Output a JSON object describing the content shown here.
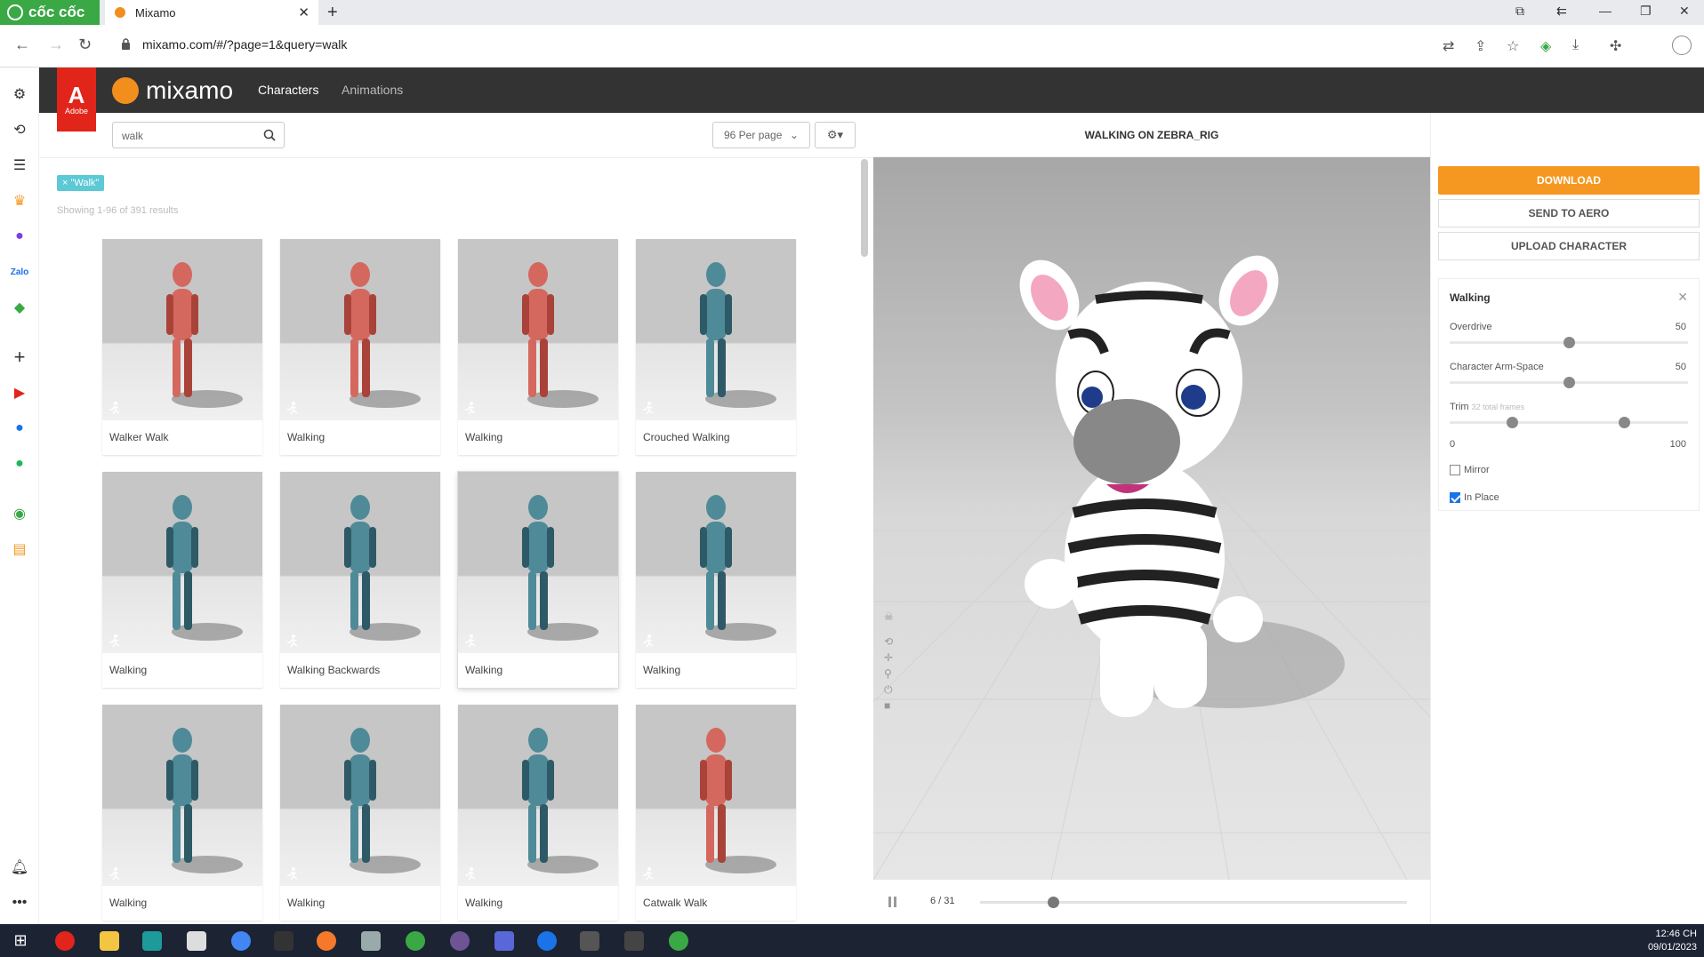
{
  "browser": {
    "brand": "cốc cốc",
    "tab_title": "Mixamo",
    "url": "mixamo.com/#/?page=1&query=walk"
  },
  "mixamo": {
    "logo_text": "mixamo",
    "adobe_label": "Adobe",
    "nav": [
      {
        "label": "Characters",
        "active": true
      },
      {
        "label": "Animations",
        "active": false
      }
    ]
  },
  "browse": {
    "search_value": "walk",
    "per_page": "96 Per page",
    "filter_chip": "× \"Walk\"",
    "results_text": "Showing 1-96 of 391 results",
    "cards": [
      {
        "label": "Walker Walk",
        "color": "red"
      },
      {
        "label": "Walking",
        "color": "red"
      },
      {
        "label": "Walking",
        "color": "red"
      },
      {
        "label": "Crouched Walking",
        "color": "blue"
      },
      {
        "label": "Walking",
        "color": "blue"
      },
      {
        "label": "Walking Backwards",
        "color": "blue"
      },
      {
        "label": "Walking",
        "color": "blue"
      },
      {
        "label": "Walking",
        "color": "blue"
      },
      {
        "label": "Walking",
        "color": "blue"
      },
      {
        "label": "Walking",
        "color": "blue"
      },
      {
        "label": "Walking",
        "color": "blue"
      },
      {
        "label": "Catwalk Walk",
        "color": "red"
      }
    ]
  },
  "viewer": {
    "title": "WALKING ON ZEBRA_RIG",
    "frame_label": "6 / 31",
    "timeline_progress": 0.17
  },
  "panel": {
    "download_label": "DOWNLOAD",
    "aero_label": "SEND TO AERO",
    "upload_label": "UPLOAD CHARACTER",
    "animation_name": "Walking",
    "overdrive_label": "Overdrive",
    "overdrive_value": "50",
    "overdrive_fraction": 0.5,
    "armspace_label": "Character Arm-Space",
    "armspace_value": "50",
    "armspace_fraction": 0.5,
    "trim_label": "Trim",
    "trim_note": "32 total frames",
    "trim_min": "0",
    "trim_max": "100",
    "trim_start_fraction": 0.26,
    "trim_end_fraction": 0.73,
    "mirror_label": "Mirror",
    "mirror_checked": false,
    "inplace_label": "In Place",
    "inplace_checked": true
  },
  "taskbar": {
    "time": "12:46 CH",
    "date": "09/01/2023"
  },
  "colors": {
    "accent_orange": "#f59821",
    "adobe_red": "#e1251b",
    "chip_teal": "#5bc9d6",
    "coccoc_green": "#3aa845"
  }
}
